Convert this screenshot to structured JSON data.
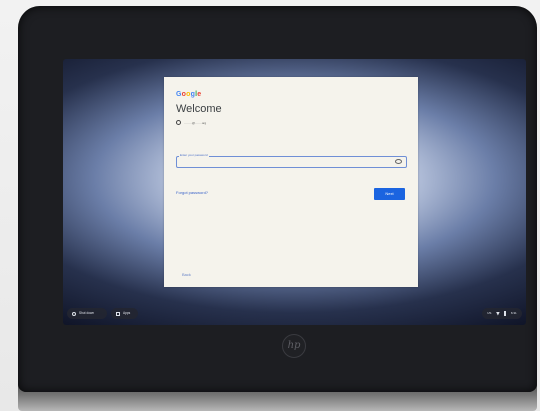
{
  "login": {
    "brand": "Google",
    "title": "Welcome",
    "account": "········@······.org",
    "password_placeholder": "Enter your password",
    "forgot_password": "Forgot password?",
    "next": "Next",
    "back": "Back"
  },
  "shelf": {
    "shut_down": "Shut down",
    "apps": "Apps"
  },
  "status": {
    "input_method": "US",
    "time": "6:31"
  },
  "colors": {
    "accent_blue": "#1b64e0",
    "dialog_bg": "#f5f3ec"
  }
}
